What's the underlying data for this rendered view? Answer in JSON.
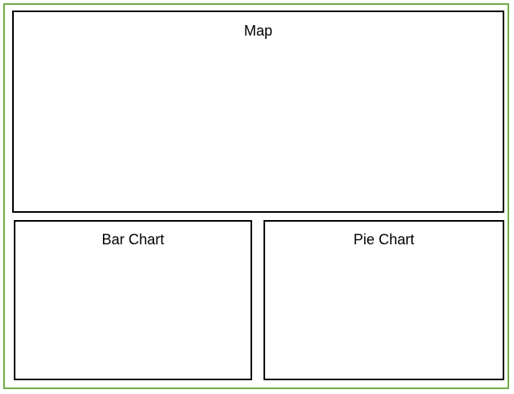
{
  "colors": {
    "frame_border": "#70ad47",
    "panel_border": "#000000",
    "background": "#ffffff"
  },
  "panels": {
    "map": {
      "label": "Map"
    },
    "bar_chart": {
      "label": "Bar Chart"
    },
    "pie_chart": {
      "label": "Pie Chart"
    }
  }
}
